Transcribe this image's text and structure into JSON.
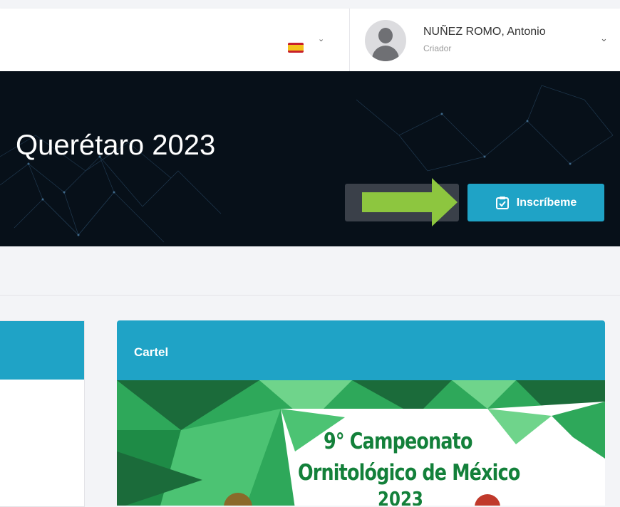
{
  "header": {
    "language_icon": "spain-flag-icon",
    "user": {
      "name": "NUÑEZ ROMO, Antonio",
      "role": "Criador"
    }
  },
  "hero": {
    "title": "Querétaro 2023",
    "register_button_label": "Inscríbeme"
  },
  "cards": {
    "poster_card": {
      "title": "Cartel",
      "poster_text_line1": "9° Campeonato",
      "poster_text_line2": "Ornitológico de México",
      "poster_text_line3": "2023"
    }
  },
  "colors": {
    "accent": "#1fa3c6",
    "hero_bg": "#071019",
    "arrow": "#8dc63f",
    "poster_green": "#13803a"
  }
}
